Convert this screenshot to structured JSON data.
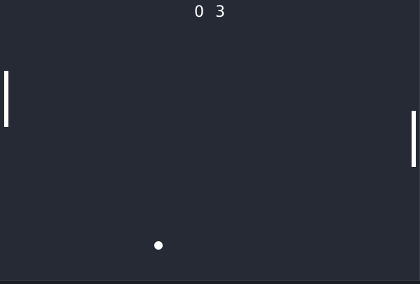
{
  "colors": {
    "background": "#252a35",
    "foreground": "#ffffff"
  },
  "score": {
    "left": "0",
    "right": "3"
  }
}
